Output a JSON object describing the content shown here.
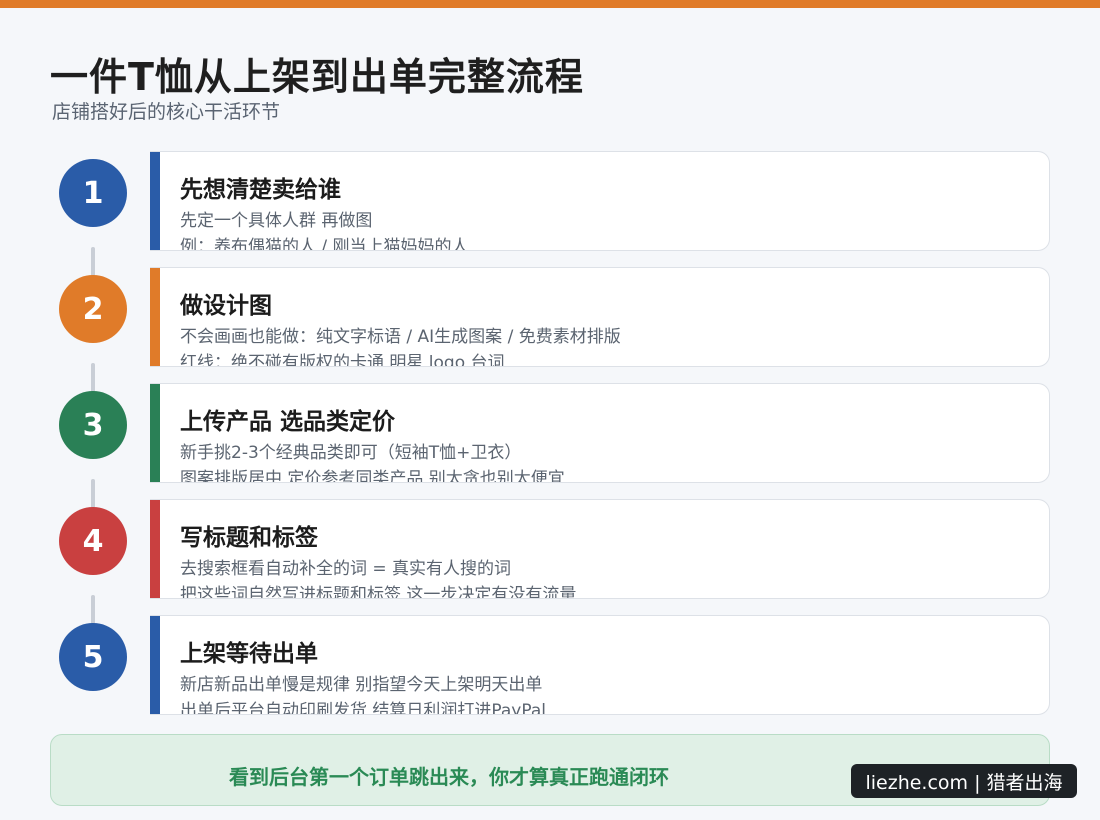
{
  "header": {
    "title": "一件T恤从上架到出单完整流程",
    "subtitle": "店铺搭好后的核心干活环节",
    "accent_color": "#e07b29"
  },
  "steps": [
    {
      "number": "1",
      "title": "先想清楚卖给谁",
      "line1": "先定一个具体人群 再做图",
      "line2": "例：养布偶猫的人 / 刚当上猫妈妈的人",
      "color": "#2a5ca8"
    },
    {
      "number": "2",
      "title": "做设计图",
      "line1": "不会画画也能做：纯文字标语 / AI生成图案 / 免费素材排版",
      "line2": "红线：绝不碰有版权的卡通 明星 logo 台词",
      "color": "#e07b29"
    },
    {
      "number": "3",
      "title": "上传产品 选品类定价",
      "line1": "新手挑2-3个经典品类即可（短袖T恤+卫衣）",
      "line2": "图案排版居中 定价参考同类产品 别太贪也别太便宜",
      "color": "#2a8056"
    },
    {
      "number": "4",
      "title": "写标题和标签",
      "line1": "去搜索框看自动补全的词 = 真实有人搜的词",
      "line2": "把这些词自然写进标题和标签 这一步决定有没有流量",
      "color": "#c94040"
    },
    {
      "number": "5",
      "title": "上架等待出单",
      "line1": "新店新品出单慢是规律 别指望今天上架明天出单",
      "line2": "出单后平台自动印刷发货 结算日利润打进PayPal",
      "color": "#2a5ca8"
    }
  ],
  "footer": {
    "text": "看到后台第一个订单跳出来，你才算真正跑通闭环",
    "color": "#2a8a55"
  },
  "watermark": {
    "text": "liezhe.com | 猎者出海"
  }
}
